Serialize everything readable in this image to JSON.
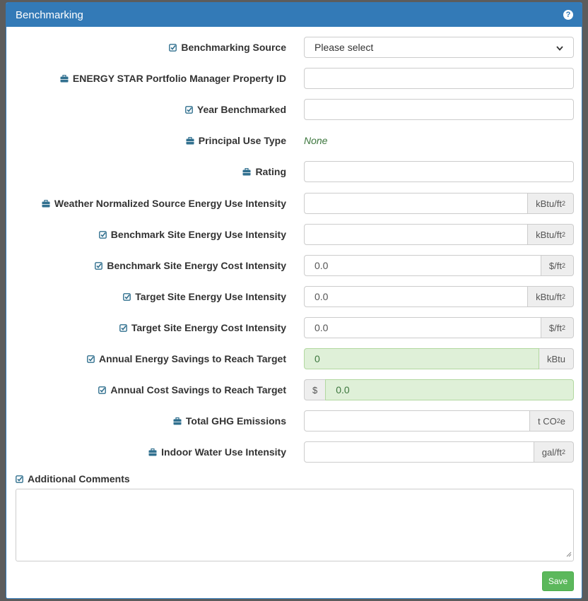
{
  "panel": {
    "title": "Benchmarking",
    "help_glyph": "?"
  },
  "fields": [
    {
      "label": "Benchmarking Source",
      "icon": "checkbox-icon",
      "type": "select",
      "value": "Please select"
    },
    {
      "label": "ENERGY STAR Portfolio Manager Property ID",
      "icon": "briefcase-icon",
      "type": "input",
      "value": ""
    },
    {
      "label": "Year Benchmarked",
      "icon": "checkbox-icon",
      "type": "input",
      "value": ""
    },
    {
      "label": "Principal Use Type",
      "icon": "briefcase-icon",
      "type": "static",
      "value": "None"
    },
    {
      "label": "Rating",
      "icon": "briefcase-icon",
      "type": "input",
      "value": ""
    },
    {
      "label": "Weather Normalized Source Energy Use Intensity",
      "icon": "briefcase-icon",
      "type": "input",
      "value": "",
      "unit": "kBtu/ft",
      "unit_sup": "2"
    },
    {
      "label": "Benchmark Site Energy Use Intensity",
      "icon": "checkbox-icon",
      "type": "input",
      "value": "",
      "unit": "kBtu/ft",
      "unit_sup": "2"
    },
    {
      "label": "Benchmark Site Energy Cost Intensity",
      "icon": "checkbox-icon",
      "type": "input",
      "value": "0.0",
      "unit": "$/ft",
      "unit_sup": "2"
    },
    {
      "label": "Target Site Energy Use Intensity",
      "icon": "checkbox-icon",
      "type": "input",
      "value": "0.0",
      "unit": "kBtu/ft",
      "unit_sup": "2"
    },
    {
      "label": "Target Site Energy Cost Intensity",
      "icon": "checkbox-icon",
      "type": "input",
      "value": "0.0",
      "unit": "$/ft",
      "unit_sup": "2"
    },
    {
      "label": "Annual Energy Savings to Reach Target",
      "icon": "checkbox-icon",
      "type": "input-success",
      "value": "0",
      "unit": "kBtu"
    },
    {
      "label": "Annual Cost Savings to Reach Target",
      "icon": "checkbox-icon",
      "type": "input-success",
      "value": "0.0",
      "prefix": "$"
    },
    {
      "label": "Total GHG Emissions",
      "icon": "briefcase-icon",
      "type": "input",
      "value": "",
      "unit": "t CO",
      "unit_sub": "2",
      "unit_tail": "e"
    },
    {
      "label": "Indoor Water Use Intensity",
      "icon": "briefcase-icon",
      "type": "input",
      "value": "",
      "unit": "gal/ft",
      "unit_sup": "2"
    }
  ],
  "comments": {
    "label": "Additional Comments",
    "icon": "checkbox-icon",
    "value": ""
  },
  "save": {
    "label": "Save"
  },
  "colors": {
    "header": "#337ab7",
    "success_bg": "#dff0d8",
    "save_btn": "#5cb85c",
    "static_text": "#3c763d"
  }
}
